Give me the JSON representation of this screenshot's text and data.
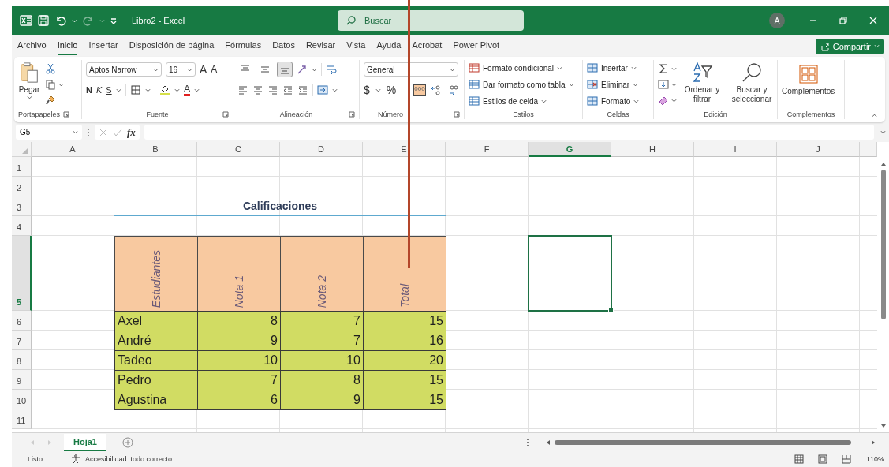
{
  "title_bar": {
    "title": "Libro2 - Excel",
    "search": {
      "placeholder": "Buscar"
    },
    "account_initial": "A"
  },
  "menu_tabs": [
    {
      "label": "Archivo",
      "selected": false
    },
    {
      "label": "Inicio",
      "selected": true
    },
    {
      "label": "Insertar",
      "selected": false
    },
    {
      "label": "Disposición de página",
      "selected": false
    },
    {
      "label": "Fórmulas",
      "selected": false
    },
    {
      "label": "Datos",
      "selected": false
    },
    {
      "label": "Revisar",
      "selected": false
    },
    {
      "label": "Vista",
      "selected": false
    },
    {
      "label": "Ayuda",
      "selected": false
    },
    {
      "label": "Acrobat",
      "selected": false
    },
    {
      "label": "Power Pivot",
      "selected": false
    }
  ],
  "share_button": {
    "label": "Compartir"
  },
  "ribbon": {
    "clipboard": {
      "paste": "Pegar",
      "label": "Portapapeles"
    },
    "font": {
      "name": "Aptos Narrow",
      "size": "16",
      "grow": "A",
      "shrink": "A",
      "bold": "N",
      "italic": "K",
      "underline": "S",
      "font_color_letter": "A",
      "label": "Fuente"
    },
    "alignment": {
      "vertical_buttons": [
        {
          "selected": false
        },
        {
          "selected": false
        },
        {
          "selected": true
        }
      ],
      "label": "Alineación"
    },
    "number": {
      "format": "General",
      "currency": "$",
      "percent": "%",
      "thousands": "000",
      "label": "Número"
    },
    "styles": {
      "items": [
        "Formato condicional",
        "Dar formato como tabla",
        "Estilos de celda"
      ],
      "label": "Estilos"
    },
    "cells": {
      "items": [
        "Insertar",
        "Eliminar",
        "Formato"
      ],
      "label": "Celdas"
    },
    "editing": {
      "sort": "Ordenar y filtrar",
      "find": "Buscar y seleccionar",
      "label": "Edición"
    },
    "addins": {
      "button": "Complementos",
      "label": "Complementos"
    }
  },
  "formula_bar": {
    "name_box": "G5",
    "function_label": "fx"
  },
  "sheet": {
    "columns": [
      {
        "label": "A",
        "selected": false
      },
      {
        "label": "B",
        "selected": false
      },
      {
        "label": "C",
        "selected": false
      },
      {
        "label": "D",
        "selected": false
      },
      {
        "label": "E",
        "selected": false
      },
      {
        "label": "F",
        "selected": false
      },
      {
        "label": "G",
        "selected": true
      },
      {
        "label": "H",
        "selected": false
      },
      {
        "label": "I",
        "selected": false
      },
      {
        "label": "J",
        "selected": false
      }
    ],
    "rows": [
      {
        "label": "1",
        "selected": false
      },
      {
        "label": "2",
        "selected": false
      },
      {
        "label": "3",
        "selected": false
      },
      {
        "label": "4",
        "selected": false
      },
      {
        "label": "5",
        "selected": true
      },
      {
        "label": "6",
        "selected": false
      },
      {
        "label": "7",
        "selected": false
      },
      {
        "label": "8",
        "selected": false
      },
      {
        "label": "9",
        "selected": false
      },
      {
        "label": "10",
        "selected": false
      },
      {
        "label": "11",
        "selected": false
      }
    ],
    "title": "Calificaciones",
    "table": {
      "headers": [
        "Estudiantes",
        "Nota 1",
        "Nota 2",
        "Total"
      ],
      "rows": [
        [
          "Axel",
          "8",
          "7",
          "15"
        ],
        [
          "André",
          "9",
          "7",
          "16"
        ],
        [
          "Tadeo",
          "10",
          "10",
          "20"
        ],
        [
          "Pedro",
          "7",
          "8",
          "15"
        ],
        [
          "Agustina",
          "6",
          "9",
          "15"
        ]
      ]
    }
  },
  "sheet_tabs": [
    {
      "label": "Hoja1",
      "selected": true
    }
  ],
  "status_bar": {
    "status": "Listo",
    "accessibility": "Accesibilidad: todo correcto",
    "zoom": "110%"
  }
}
